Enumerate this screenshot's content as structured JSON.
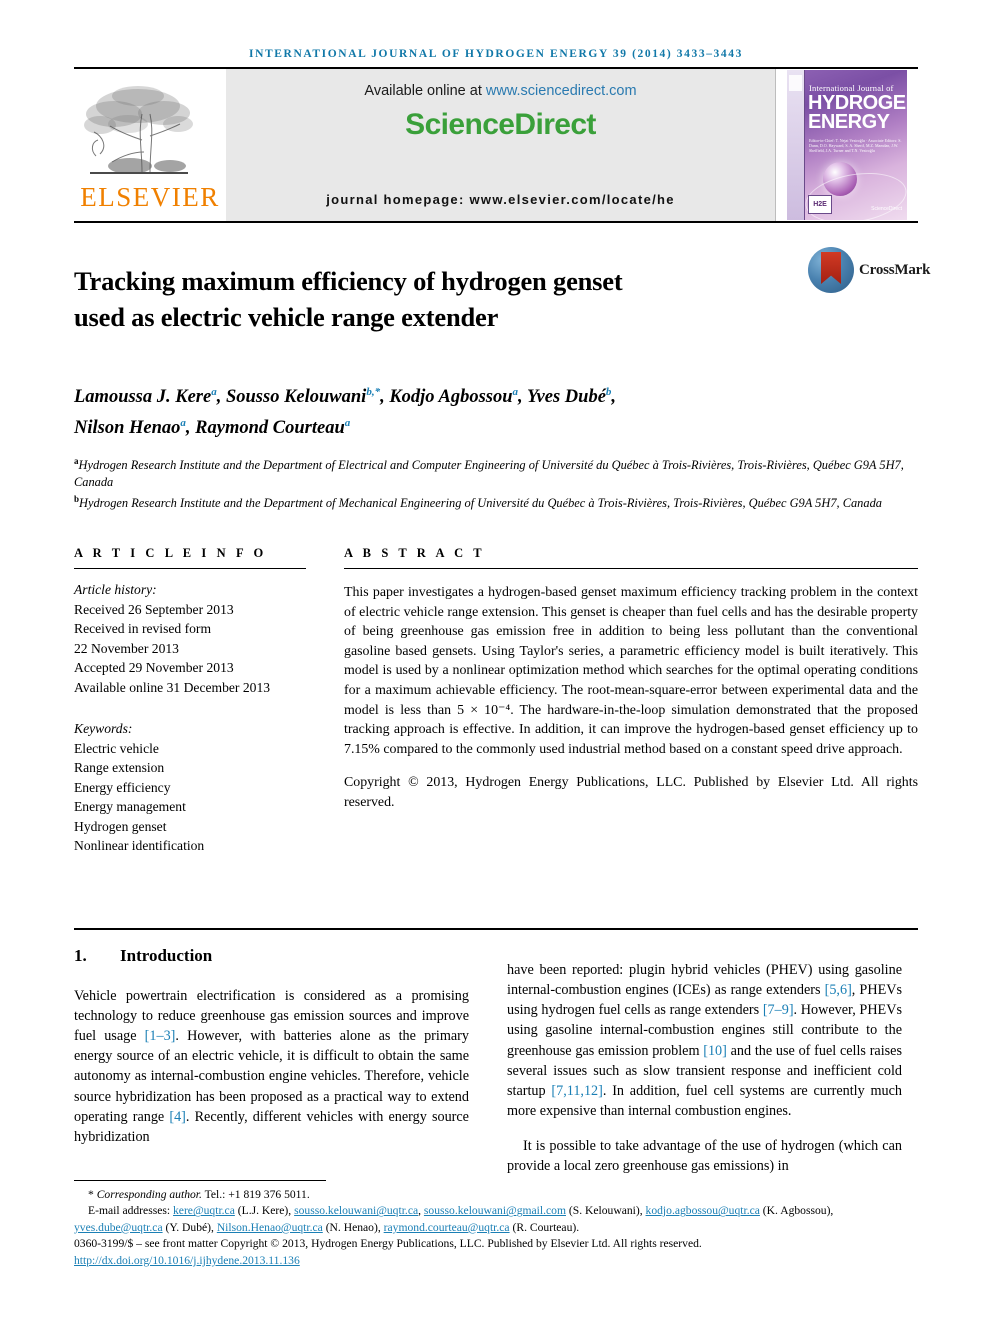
{
  "running_head": "INTERNATIONAL JOURNAL OF HYDROGEN ENERGY 39 (2014) 3433–3443",
  "masthead": {
    "publisher_name": "ELSEVIER",
    "available_prefix": "Available online at ",
    "available_url": "www.sciencedirect.com",
    "sciencedirect_part1": "Science",
    "sciencedirect_part2": "Direct",
    "journal_homepage": "journal homepage: www.elsevier.com/locate/he",
    "cover": {
      "line_small": "International Journal of",
      "line_big_1": "HYDROGEN",
      "line_big_2": "ENERGY",
      "editors": "Editor-in-Chief: T. Nejat Veziroğlu  ·  Associate Editors: S. Dunn, D.O. Hayward, S. A. Sherif, M.Z. Mamdan, J.W. Sheffield, J.A. Turner and T.N. Veziroğlu",
      "badge": "H2E",
      "sciencedirect_mark": "ScienceDirect"
    },
    "accent_blue": "#1178a8",
    "accent_green": "#3aa03a",
    "accent_orange": "#f08000"
  },
  "crossmark": {
    "label": "CrossMark"
  },
  "article": {
    "title_line1": "Tracking maximum efficiency of hydrogen genset",
    "title_line2": "used as electric vehicle range extender",
    "authors": [
      {
        "name": "Lamoussa J. Kere",
        "sup": "a",
        "sep": ", "
      },
      {
        "name": "Sousso Kelouwani",
        "sup": "b,*",
        "sep": ", "
      },
      {
        "name": "Kodjo Agbossou",
        "sup": "a",
        "sep": ", "
      },
      {
        "name": "Yves Dubé",
        "sup": "b",
        "sep": ", "
      },
      {
        "name": "Nilson Henao",
        "sup": "a",
        "sep": ", "
      },
      {
        "name": "Raymond Courteau",
        "sup": "a",
        "sep": ""
      }
    ],
    "affiliations": [
      {
        "sup": "a",
        "text": "Hydrogen Research Institute and the Department of Electrical and Computer Engineering of Université du Québec à Trois-Rivières, Trois-Rivières, Québec G9A 5H7, Canada"
      },
      {
        "sup": "b",
        "text": "Hydrogen Research Institute and the Department of Mechanical Engineering of Université du Québec à Trois-Rivières, Trois-Rivières, Québec G9A 5H7, Canada"
      }
    ]
  },
  "article_info": {
    "heading": "A R T I C L E   I N F O",
    "history_label": "Article history:",
    "history": [
      "Received 26 September 2013",
      "Received in revised form",
      "22 November 2013",
      "Accepted 29 November 2013",
      "Available online 31 December 2013"
    ],
    "keywords_label": "Keywords:",
    "keywords": [
      "Electric vehicle",
      "Range extension",
      "Energy efficiency",
      "Energy management",
      "Hydrogen genset",
      "Nonlinear identification"
    ]
  },
  "abstract": {
    "heading": "A B S T R A C T",
    "body": "This paper investigates a hydrogen-based genset maximum efficiency tracking problem in the context of electric vehicle range extension. This genset is cheaper than fuel cells and has the desirable property of being greenhouse gas emission free in addition to being less pollutant than the conventional gasoline based gensets. Using Taylor's series, a parametric efficiency model is built iteratively. This model is used by a nonlinear optimization method which searches for the optimal operating conditions for a maximum achievable efficiency. The root-mean-square-error between experimental data and the model is less than 5 × 10⁻⁴. The hardware-in-the-loop simulation demonstrated that the proposed tracking approach is effective. In addition, it can improve the hydrogen-based genset efficiency up to 7.15% compared to the commonly used industrial method based on a constant speed drive approach.",
    "copyright": "Copyright © 2013, Hydrogen Energy Publications, LLC. Published by Elsevier Ltd. All rights reserved."
  },
  "introduction": {
    "number": "1.",
    "heading": "Introduction",
    "left_para_1_a": "Vehicle powertrain electrification is considered as a promising technology to reduce greenhouse gas emission sources and improve fuel usage ",
    "left_cite_1": "[1–3]",
    "left_para_1_b": ". However, with batteries alone as the primary energy source of an electric vehicle, it is difficult to obtain the same autonomy as internal-combustion engine vehicles. Therefore, vehicle source hybridization has been proposed as a practical way to extend operating range ",
    "left_cite_2": "[4]",
    "left_para_1_c": ". Recently, different vehicles with energy source hybridization",
    "right_para_1_a": "have been reported: plugin hybrid vehicles (PHEV) using gasoline internal-combustion engines (ICEs) as range extenders ",
    "right_cite_1": "[5,6]",
    "right_para_1_b": ", PHEVs using hydrogen fuel cells as range extenders ",
    "right_cite_2": "[7–9]",
    "right_para_1_c": ". However, PHEVs using gasoline internal-combustion engines still contribute to the greenhouse gas emission problem ",
    "right_cite_3": "[10]",
    "right_para_1_d": " and the use of fuel cells raises several issues such as slow transient response and inefficient cold startup ",
    "right_cite_4": "[7,11,12]",
    "right_para_1_e": ". In addition, fuel cell systems are currently much more expensive than internal combustion engines.",
    "right_para_2": "It is possible to take advantage of the use of hydrogen (which can provide a local zero greenhouse gas emissions) in"
  },
  "footnote": {
    "corresponding_marker": "*",
    "corresponding_label": "Corresponding author.",
    "corresponding_tel": " Tel.: +1 819 376 5011.",
    "email_label": "E-mail addresses: ",
    "emails": [
      {
        "addr": "kere@uqtr.ca",
        "who": " (L.J. Kere), "
      },
      {
        "addr": "sousso.kelouwani@uqtr.ca",
        "who": ", "
      },
      {
        "addr": "sousso.kelouwani@gmail.com",
        "who": " (S. Kelouwani), "
      },
      {
        "addr": "kodjo.agbossou@uqtr.ca",
        "who": " (K. Agbossou), "
      },
      {
        "addr": "yves.dube@uqtr.ca",
        "who": " (Y. Dubé), "
      },
      {
        "addr": "Nilson.Henao@uqtr.ca",
        "who": " (N. Henao), "
      },
      {
        "addr": "raymond.courteau@uqtr.ca",
        "who": " (R. Courteau)."
      }
    ],
    "issn_line": "0360-3199/$ – see front matter Copyright © 2013, Hydrogen Energy Publications, LLC. Published by Elsevier Ltd. All rights reserved.",
    "doi": "http://dx.doi.org/10.1016/j.ijhydene.2013.11.136"
  }
}
